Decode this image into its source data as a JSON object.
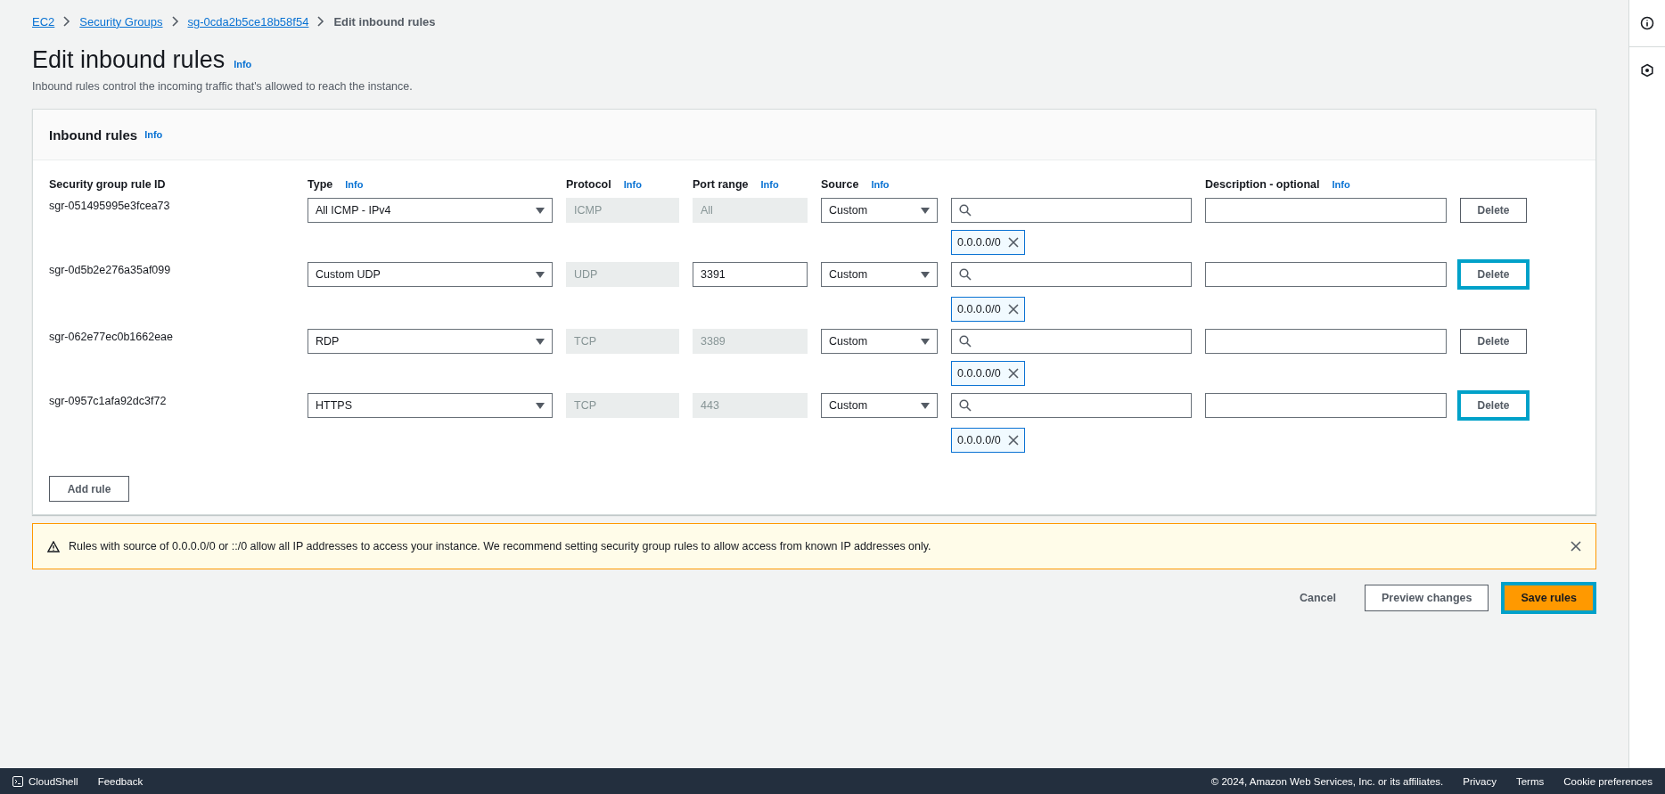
{
  "breadcrumb": [
    {
      "label": "EC2",
      "kind": "link"
    },
    {
      "label": "Security Groups",
      "kind": "link"
    },
    {
      "label": "sg-0cda2b5ce18b58f54",
      "kind": "link"
    },
    {
      "label": "Edit inbound rules",
      "kind": "current"
    }
  ],
  "page": {
    "title": "Edit inbound rules",
    "info": "Info",
    "subtitle": "Inbound rules control the incoming traffic that's allowed to reach the instance."
  },
  "panel": {
    "title": "Inbound rules",
    "info": "Info",
    "columns": [
      {
        "label": "Security group rule ID"
      },
      {
        "label": "Type",
        "info": "Info"
      },
      {
        "label": "Protocol",
        "info": "Info"
      },
      {
        "label": "Port range",
        "info": "Info"
      },
      {
        "label": "Source",
        "info": "Info"
      },
      {
        "label": "Description - optional",
        "info": "Info"
      }
    ],
    "rows": [
      {
        "id": "sgr-051495995e3fcea73",
        "type": "All ICMP - IPv4",
        "protocol": "ICMP",
        "port": "All",
        "port_disabled": true,
        "source": "Custom",
        "sources": [
          "0.0.0.0/0"
        ],
        "delete": "Delete",
        "delete_highlighted": false
      },
      {
        "id": "sgr-0d5b2e276a35af099",
        "type": "Custom UDP",
        "protocol": "UDP",
        "port": "3391",
        "port_disabled": false,
        "source": "Custom",
        "sources": [
          "0.0.0.0/0"
        ],
        "delete": "Delete",
        "delete_highlighted": true
      },
      {
        "id": "sgr-062e77ec0b1662eae",
        "type": "RDP",
        "protocol": "TCP",
        "port": "3389",
        "port_disabled": true,
        "source": "Custom",
        "sources": [
          "0.0.0.0/0"
        ],
        "delete": "Delete",
        "delete_highlighted": false
      },
      {
        "id": "sgr-0957c1afa92dc3f72",
        "type": "HTTPS",
        "protocol": "TCP",
        "port": "443",
        "port_disabled": true,
        "source": "Custom",
        "sources": [
          "0.0.0.0/0"
        ],
        "delete": "Delete",
        "delete_highlighted": true
      }
    ],
    "add_button": "Add rule"
  },
  "warning": {
    "text": "Rules with source of 0.0.0.0/0 or ::/0 allow all IP addresses to access your instance. We recommend setting security group rules to allow access from known IP addresses only."
  },
  "actions": [
    {
      "label": "Cancel",
      "kind": "link",
      "highlighted": false
    },
    {
      "label": "Preview changes",
      "kind": "normal",
      "highlighted": false
    },
    {
      "label": "Save rules",
      "kind": "primary",
      "highlighted": true
    }
  ],
  "footer": {
    "left": [
      "CloudShell",
      "Feedback"
    ],
    "copyright": "© 2024, Amazon Web Services, Inc. or its affiliates.",
    "links": [
      "Privacy",
      "Terms",
      "Cookie preferences"
    ]
  }
}
